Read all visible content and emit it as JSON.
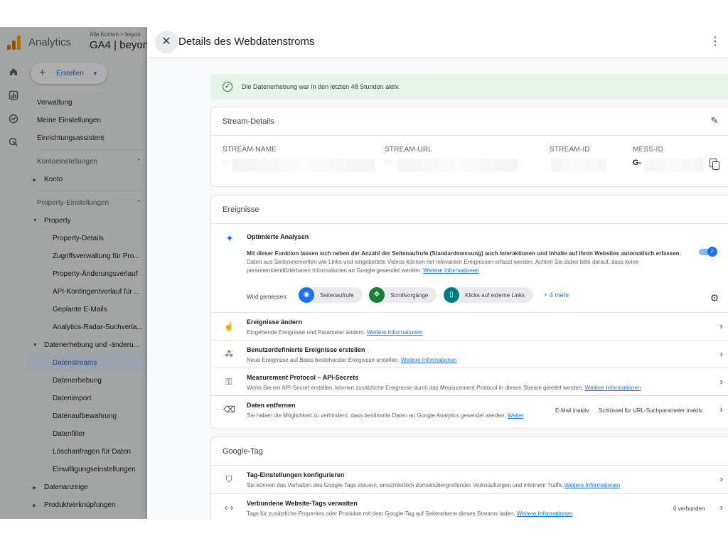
{
  "app": {
    "name": "Analytics",
    "breadcrumb": "Alle Konten > beyon",
    "property": "GA4 | beyon",
    "create_button": "Erstellen",
    "logo_colors": [
      "#f9ab00",
      "#e37400",
      "#e37400"
    ]
  },
  "rail": {
    "icons": [
      "home-icon",
      "reports-icon",
      "explore-icon",
      "advertising-icon"
    ]
  },
  "sidebar": {
    "items": [
      {
        "label": "Verwaltung"
      },
      {
        "label": "Meine Einstellungen"
      },
      {
        "label": "Einrichtungsassistent"
      },
      {
        "label": "Kontoeinstellungen"
      },
      {
        "label": "Konto"
      },
      {
        "label": "Property-Einstellungen"
      },
      {
        "label": "Property"
      },
      {
        "label": "Property-Details"
      },
      {
        "label": "Zugriffsverwaltung für Pro..."
      },
      {
        "label": "Property-Änderungsverlauf"
      },
      {
        "label": "API-Kontingentverlauf für ..."
      },
      {
        "label": "Geplante E-Mails"
      },
      {
        "label": "Analytics-Radar-Suchverla..."
      },
      {
        "label": "Datenerhebung und -änderu..."
      },
      {
        "label": "Datenstreams"
      },
      {
        "label": "Datenerhebung"
      },
      {
        "label": "Datenimport"
      },
      {
        "label": "Datenaufbewahrung"
      },
      {
        "label": "Datenfilter"
      },
      {
        "label": "Löschanfragen für Daten"
      },
      {
        "label": "Einwilligungseinstellungen"
      },
      {
        "label": "Datenanzeige"
      },
      {
        "label": "Produktverknüpfungen"
      }
    ]
  },
  "panel": {
    "title": "Details des Webdatenstroms",
    "status_banner": "Die Datenerhebung war in den letzten 48 Stunden aktiv.",
    "stream_details": {
      "heading": "Stream-Details",
      "labels": [
        "STREAM-NAME",
        "STREAM-URL",
        "STREAM-ID",
        "MESS-ID"
      ],
      "values": [
        "w",
        "ht",
        "/",
        "G-"
      ]
    },
    "events": {
      "heading": "Ereignisse",
      "enhanced_title": "Optimierte Analysen",
      "enhanced_desc_bold": "Mit dieser Funktion lassen sich neben der Anzahl der Seitenaufrufe (Standardmessung) auch Interaktionen und Inhalte auf Ihren Websites automatisch erfassen.",
      "enhanced_desc": "Daten aus Seitenelementen wie Links und eingebettete Videos können mit relevanten Ereignissen erfasst werden. Achten Sie dabei bitte darauf, dass keine personenidentifizierbaren Informationen an Google gesendet werden.",
      "learn_more": "Weitere Informationen",
      "measured_label": "Wird gemessen:",
      "chips": [
        {
          "label": "Seitenaufrufe",
          "color": "#1a73e8",
          "icon": "eye-icon"
        },
        {
          "label": "Scrollvorgänge",
          "color": "#188038",
          "icon": "scroll-icon"
        },
        {
          "label": "Klicks auf externe Links",
          "color": "#007b83",
          "icon": "mouse-icon"
        }
      ],
      "more": "+ 4 mehr",
      "rows": [
        {
          "title": "Ereignisse ändern",
          "desc": "Eingehende Ereignisse und Parameter ändern.",
          "link": "Weitere Informationen"
        },
        {
          "title": "Benutzerdefinierte Ereignisse erstellen",
          "desc": "Neue Ereignisse auf Basis bestehender Ereignisse erstellen.",
          "link": "Weitere Informationen"
        },
        {
          "title": "Measurement Protocol – API-Secrets",
          "desc": "Wenn Sie ein API-Secret erstellen, können zusätzliche Ereignisse durch das Measurement Protocol in diesen Stream geleitet werden.",
          "link": "Weitere Informationen"
        },
        {
          "title": "Daten entfernen",
          "desc": "Sie haben die Möglichkeit zu verhindern, dass bestimmte Daten an Google Analytics gesendet werden.",
          "link": "Weiter",
          "status1": "E-Mail inaktiv",
          "status2": "Schlüssel für URL-Suchparameter inaktiv"
        }
      ]
    },
    "google_tag": {
      "heading": "Google-Tag",
      "rows": [
        {
          "title": "Tag-Einstellungen konfigurieren",
          "desc": "Sie können das Verhalten des Google-Tags steuern, einschließlich domainübergreifender Verknüpfungen und internem Traffic.",
          "link": "Weitere Informationen"
        },
        {
          "title": "Verbundene Website-Tags verwalten",
          "desc": "Tags für zusätzliche Properties oder Produkte mit dem Google-Tag auf Seitenebene dieses Streams laden.",
          "link": "Weitere Informationen",
          "status": "0 verbunden"
        }
      ]
    }
  }
}
